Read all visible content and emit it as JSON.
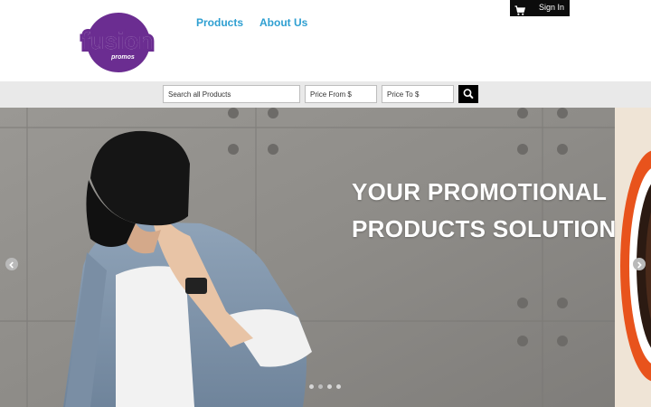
{
  "header": {
    "logo": {
      "word": "fusion",
      "subword": "promos",
      "color": "#6b2d91"
    },
    "nav": [
      {
        "label": "Products"
      },
      {
        "label": "About Us"
      }
    ],
    "signin_label": "Sign In",
    "link_color": "#2e9fd1"
  },
  "search": {
    "keyword_placeholder": "Search all Products",
    "price_from_placeholder": "Price From $",
    "price_to_placeholder": "Price To $",
    "button_icon": "search-icon"
  },
  "hero": {
    "title_line1": "YOUR PROMOTIONAL",
    "title_line2": "PRODUCTS SOLUTION",
    "slides_count": 4,
    "active_slide": 1,
    "prev_icon": "chevron-left-icon",
    "next_icon": "chevron-right-icon"
  }
}
